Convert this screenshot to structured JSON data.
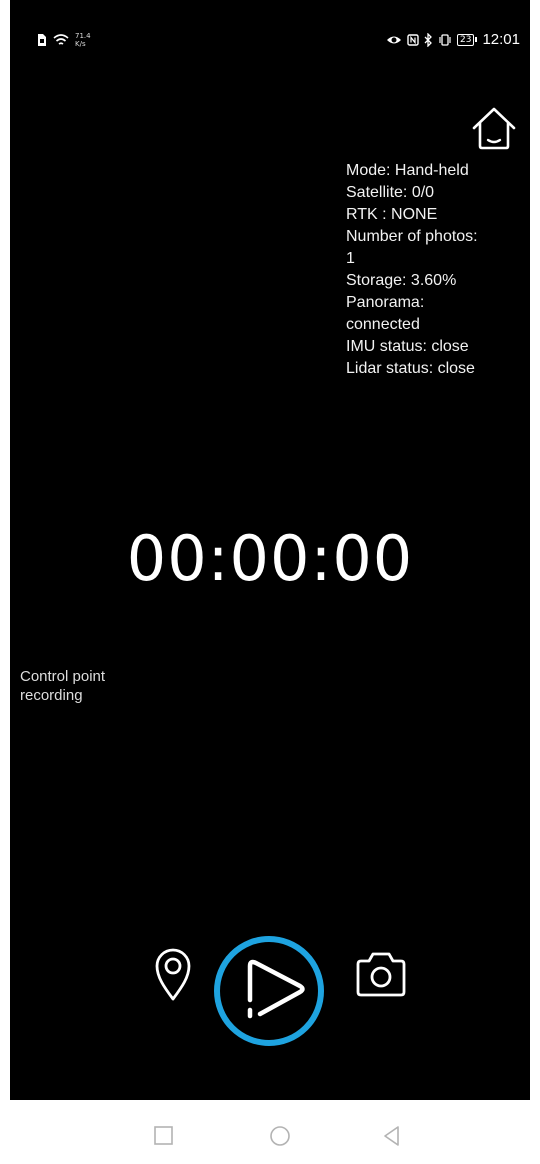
{
  "status_bar": {
    "net_speed_value": "71.4",
    "net_speed_unit": "K/s",
    "icons": [
      "sim-icon",
      "wifi-icon",
      "eye-icon",
      "nfc-icon",
      "bluetooth-icon",
      "vibrate-icon",
      "battery-icon"
    ],
    "battery_level": "23",
    "time": "12:01"
  },
  "header": {
    "home_icon": "home-icon"
  },
  "info": {
    "mode": "Mode:  Hand-held",
    "satellite": "Satellite:  0/0",
    "rtk": "RTK :  NONE",
    "photos_label": "Number of photos:",
    "photos_value": "1",
    "storage": "Storage:  3.60%",
    "panorama_label": "Panorama:",
    "panorama_value": "connected",
    "imu_status": "IMU status:  close",
    "lidar_status": "Lidar status:  close"
  },
  "timer": "00:00:00",
  "control_point": "Control point recording",
  "controls": {
    "location_icon": "location-pin-icon",
    "play_icon": "play-icon",
    "camera_icon": "camera-icon",
    "highlight_color": "#1ea3e0"
  },
  "nav_bar": {
    "icons": [
      "recent-apps-icon",
      "home-circle-icon",
      "back-icon"
    ]
  }
}
